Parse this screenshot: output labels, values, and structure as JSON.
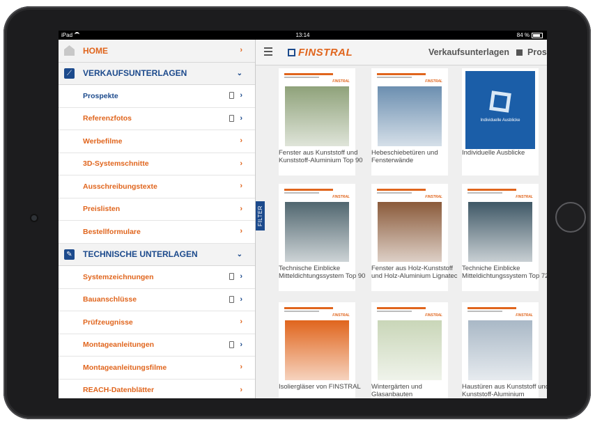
{
  "status_bar": {
    "device": "iPad",
    "time": "13:14",
    "battery": "84 %",
    "battery_level": 0.84
  },
  "sidebar": {
    "items": [
      {
        "label": "HOME",
        "type": "section",
        "icon": "home-icon",
        "chevron": "›"
      },
      {
        "label": "VERKAUFSUNTERLAGEN",
        "type": "section",
        "icon": "chart-icon",
        "chevron": "⌄",
        "color": "blue"
      },
      {
        "label": "Prospekte",
        "type": "item",
        "device": true,
        "chevron": "›",
        "color": "blue"
      },
      {
        "label": "Referenzfotos",
        "type": "item",
        "device": true,
        "chevron": "›"
      },
      {
        "label": "Werbefilme",
        "type": "item",
        "device": false,
        "chevron": "›"
      },
      {
        "label": "3D-Systemschnitte",
        "type": "item",
        "device": false,
        "chevron": "›"
      },
      {
        "label": "Ausschreibungstexte",
        "type": "item",
        "device": false,
        "chevron": "›"
      },
      {
        "label": "Preislisten",
        "type": "item",
        "device": false,
        "chevron": "›"
      },
      {
        "label": "Bestellformulare",
        "type": "item",
        "device": false,
        "chevron": "›"
      },
      {
        "label": "TECHNISCHE UNTERLAGEN",
        "type": "section",
        "icon": "wrench-icon",
        "chevron": "⌄",
        "color": "blue"
      },
      {
        "label": "Systemzeichnungen",
        "type": "item",
        "device": true,
        "chevron": "›"
      },
      {
        "label": "Bauanschlüsse",
        "type": "item",
        "device": true,
        "chevron": "›"
      },
      {
        "label": "Prüfzeugnisse",
        "type": "item",
        "device": false,
        "chevron": "›"
      },
      {
        "label": "Montageanleitungen",
        "type": "item",
        "device": true,
        "chevron": "›"
      },
      {
        "label": "Montageanleitungsfilme",
        "type": "item",
        "device": false,
        "chevron": "›"
      },
      {
        "label": "REACH-Datenblätter",
        "type": "item",
        "device": false,
        "chevron": "›"
      }
    ]
  },
  "filter_tab": {
    "label": "FILTER"
  },
  "topbar": {
    "logo": "FINSTRAL",
    "crumb_1": "Verkaufsunterlagen",
    "crumb_2": "Pros"
  },
  "cover_brand": "FINSTRAL",
  "blue_cover_text": "Individuelle Ausblicke",
  "documents": [
    {
      "caption": "Fenster aus Kunststoff und Kunststoff-Aluminium Top 90",
      "style": "photo",
      "photo_color": "#8fa27a"
    },
    {
      "caption": "Hebeschiebetüren und Fensterwände",
      "style": "photo",
      "photo_color": "#6c8fb0"
    },
    {
      "caption": "Individuelle Ausblicke",
      "style": "blue"
    },
    {
      "caption": "Technische Einblicke Mitteldichtungssystem Top 90",
      "style": "photo",
      "photo_color": "#50666f"
    },
    {
      "caption": "Fenster aus Holz-Kunststoff und Holz-Aluminium Lignatec",
      "style": "photo",
      "photo_color": "#8a5a3a"
    },
    {
      "caption": "Techniche Einblicke Mitteldichtungssystem Top 72",
      "style": "photo",
      "photo_color": "#3f5866"
    },
    {
      "caption": "Isoliergläser von FINSTRAL",
      "style": "photo",
      "photo_color": "#e0651d"
    },
    {
      "caption": "Wintergärten und Glasanbauten",
      "style": "photo",
      "photo_color": "#c9d6b8"
    },
    {
      "caption": "Haustüren aus Kunststoff und Kunststoff-Aluminium",
      "style": "photo",
      "photo_color": "#a9b8c6"
    }
  ],
  "colors": {
    "accent": "#e0651d",
    "brand_blue": "#1c4a8c"
  }
}
